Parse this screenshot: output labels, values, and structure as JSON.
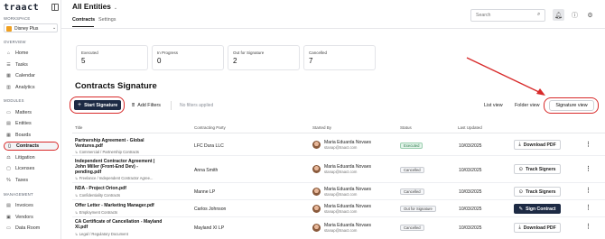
{
  "sidebar": {
    "logo": "traact",
    "workspace_label": "WORKSPACE",
    "workspace_name": "Disney Plus",
    "overview_label": "OVERVIEW",
    "modules_label": "MODULES",
    "management_label": "MANAGEMENT",
    "overview_items": [
      {
        "label": "Home",
        "icon": "home-icon"
      },
      {
        "label": "Tasks",
        "icon": "checklist-icon"
      },
      {
        "label": "Calendar",
        "icon": "calendar-icon"
      },
      {
        "label": "Analytics",
        "icon": "chart-icon"
      }
    ],
    "module_items": [
      {
        "label": "Matters",
        "icon": "briefcase-icon"
      },
      {
        "label": "Entities",
        "icon": "building-icon"
      },
      {
        "label": "Boards",
        "icon": "board-icon"
      },
      {
        "label": "Contracts",
        "icon": "document-icon",
        "active": true
      },
      {
        "label": "Litigation",
        "icon": "gavel-icon"
      },
      {
        "label": "Licenses",
        "icon": "license-icon"
      },
      {
        "label": "Taxes",
        "icon": "tax-icon"
      }
    ],
    "management_items": [
      {
        "label": "Invoices",
        "icon": "invoice-icon"
      },
      {
        "label": "Vendors",
        "icon": "vendor-icon"
      },
      {
        "label": "Data Room",
        "icon": "folder-icon"
      }
    ]
  },
  "header": {
    "title": "All Entities",
    "tabs": [
      {
        "label": "Contracts",
        "active": true
      },
      {
        "label": "Settings",
        "active": false
      }
    ],
    "search_placeholder": "Search"
  },
  "stats": [
    {
      "label": "Executed",
      "value": "5"
    },
    {
      "label": "In Progress",
      "value": "0"
    },
    {
      "label": "Out for Signature",
      "value": "2"
    },
    {
      "label": "Cancelled",
      "value": "7"
    }
  ],
  "section": {
    "title": "Contracts Signature",
    "start_button": "Start Signature",
    "add_filters": "Add Filters",
    "no_filters": "No filters applied",
    "views": [
      "List view",
      "Folder view",
      "Signature view"
    ]
  },
  "table": {
    "headers": [
      "Title",
      "Contracting Party",
      "Started By",
      "Status",
      "Last Updated"
    ],
    "rows": [
      {
        "title": "Partnership Agreement - Global Ventures.pdf",
        "category": "Commercial / Partnership Contracts",
        "party": "LFC Dura LLC",
        "starter": "Maria Eduarda Novaes",
        "email": "stanap@traact.com",
        "status": "Executed",
        "updated": "10/03/2025",
        "action": "Download PDF",
        "action_icon": "download-icon"
      },
      {
        "title": "Independent Contractor Agreement | John Miller (Front-End Dev) - pending.pdf",
        "category": "Freelance / Independent Contractor Agree...",
        "party": "Anna Smith",
        "starter": "Maria Eduarda Novaes",
        "email": "stanap@traact.com",
        "status": "Cancelled",
        "updated": "10/03/2025",
        "action": "Track Signers",
        "action_icon": "track-icon"
      },
      {
        "title": "NDA - Project Orion.pdf",
        "category": "Confidentiality Contracts",
        "party": "Manne LP",
        "starter": "Maria Eduarda Novaes",
        "email": "stanap@traact.com",
        "status": "Cancelled",
        "updated": "10/03/2025",
        "action": "Track Signers",
        "action_icon": "track-icon"
      },
      {
        "title": "Offer Letter - Marketing Manager.pdf",
        "category": "Employment Contracts",
        "party": "Carlos Johnson",
        "starter": "Maria Eduarda Novaes",
        "email": "stanap@traact.com",
        "status": "Out for Signature",
        "updated": "10/03/2025",
        "action": "Sign Contract",
        "action_icon": "pen-icon"
      },
      {
        "title": "CA Certificate of Cancellation - Mayland XI.pdf",
        "category": "Legal / Regulatory Document",
        "party": "Mayland XI LP",
        "starter": "Maria Eduarda Novaes",
        "email": "stanap@traact.com",
        "status": "Cancelled",
        "updated": "10/03/2025",
        "action": "Download PDF",
        "action_icon": "download-icon"
      }
    ]
  },
  "colors": {
    "accent": "#1d2a44",
    "highlight": "#d82a2a",
    "executed": "#2c7a4b"
  }
}
